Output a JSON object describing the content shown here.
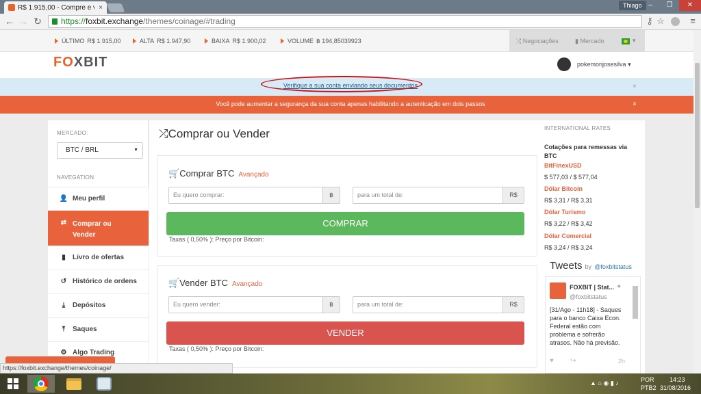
{
  "browser": {
    "tab_title": "R$ 1.915,00 - Compre e ve",
    "tab_close": "×",
    "user": "Thiago",
    "window_controls": {
      "min": "–",
      "max": "❐",
      "close": "✕"
    },
    "url_scheme": "https://",
    "url_host": "foxbit.exchange",
    "url_path": "/themes/coinage/#trading",
    "nav": {
      "back": "←",
      "forward": "→",
      "reload": "↻"
    },
    "toolbar_icons": {
      "key": "⚷",
      "star": "☆",
      "menu": "≡"
    },
    "status_url": "https://foxbit.exchange/themes/coinage/"
  },
  "ticker": {
    "last_label": "ÚLTIMO",
    "last_value": "R$ 1.915,00",
    "high_label": "ALTA",
    "high_value": "R$ 1.947,90",
    "low_label": "BAIXA",
    "low_value": "R$ 1.900,02",
    "volume_label": "VOLUME",
    "volume_value": "฿ 194,85039923"
  },
  "topnav": {
    "negociacoes": "Negociações",
    "mercado": "Mercado"
  },
  "header": {
    "logo_pre": "F",
    "logo_o": "O",
    "logo_post": "XBIT",
    "username": "pokemonjosesilva",
    "user_caret": "▾"
  },
  "alerts": {
    "verify": "Verifique a sua conta enviando seus documentos",
    "security": "Você pode aumentar a segurança da sua conta apenas habilitando a autenticação em dois passos",
    "close": "×"
  },
  "sidebar": {
    "market_label": "MERCADO:",
    "market_value": "BTC / BRL",
    "market_caret": "▼",
    "nav_label": "NAVEGATION",
    "items": [
      {
        "label": "Meu perfil",
        "icon": "👤"
      },
      {
        "label": "Comprar ou Vender",
        "icon": "⇄"
      },
      {
        "label": "Livro de ofertas",
        "icon": "▮"
      },
      {
        "label": "Histórico de ordens",
        "icon": "↺"
      },
      {
        "label": "Depósitos",
        "icon": "⤓"
      },
      {
        "label": "Saques",
        "icon": "⤒"
      },
      {
        "label": "Algo Trading",
        "icon": "⚙"
      }
    ]
  },
  "main": {
    "title": "Comprar ou Vender",
    "title_icon": "⤮",
    "buy": {
      "title": "Comprar BTC",
      "advanced": "Avançado",
      "amount_placeholder": "Eu quero comprar:",
      "amount_unit": "฿",
      "total_placeholder": "para um total de:",
      "total_unit": "R$",
      "button": "COMPRAR",
      "fee": "Taxas ( 0,50% ): Preço por Bitcoin:"
    },
    "sell": {
      "title": "Vender BTC",
      "advanced": "Avançado",
      "amount_placeholder": "Eu quero vender:",
      "amount_unit": "฿",
      "total_placeholder": "para um total de:",
      "total_unit": "R$",
      "button": "VENDER",
      "fee": "Taxas ( 0,50% ): Preço por Bitcoin:"
    }
  },
  "rates": {
    "heading": "INTERNATIONAL RATES",
    "subheading": "Cotações para remessas via BTC",
    "items": [
      {
        "name": "BitFinexUSD",
        "value": "$ 577,03 / $ 577,04"
      },
      {
        "name": "Dólar Bitcoin",
        "value": "R$ 3,31 / R$ 3,31"
      },
      {
        "name": "Dólar Turismo",
        "value": "R$ 3,22 / R$ 3,42"
      },
      {
        "name": "Dólar Comercial",
        "value": "R$ 3,24 / R$ 3,24"
      }
    ]
  },
  "tweets": {
    "title": "Tweets",
    "by": "by",
    "handle": "@foxbitstatus",
    "tweet_name": "FOXBIT | Stat...",
    "tweet_handle": "@foxbitstatus",
    "tweet_text_1": "[31/Ago - 11h18] - Saques",
    "tweet_text_2": "para o banco Caixa Econ.",
    "tweet_text_3": "Federal estão com",
    "tweet_text_4": "problema e sofrerão",
    "tweet_text_5": "atrasos. Não há previsão.",
    "tweet_time": "2h",
    "tweet_like": "♥",
    "tweet_rt": "↪"
  },
  "taskbar": {
    "lang": "POR",
    "lang_sub": "PTB2",
    "time": "14:23",
    "date": "31/08/2016",
    "tray_icons": "▲ ⌂ ◉ ▮ ♪"
  }
}
